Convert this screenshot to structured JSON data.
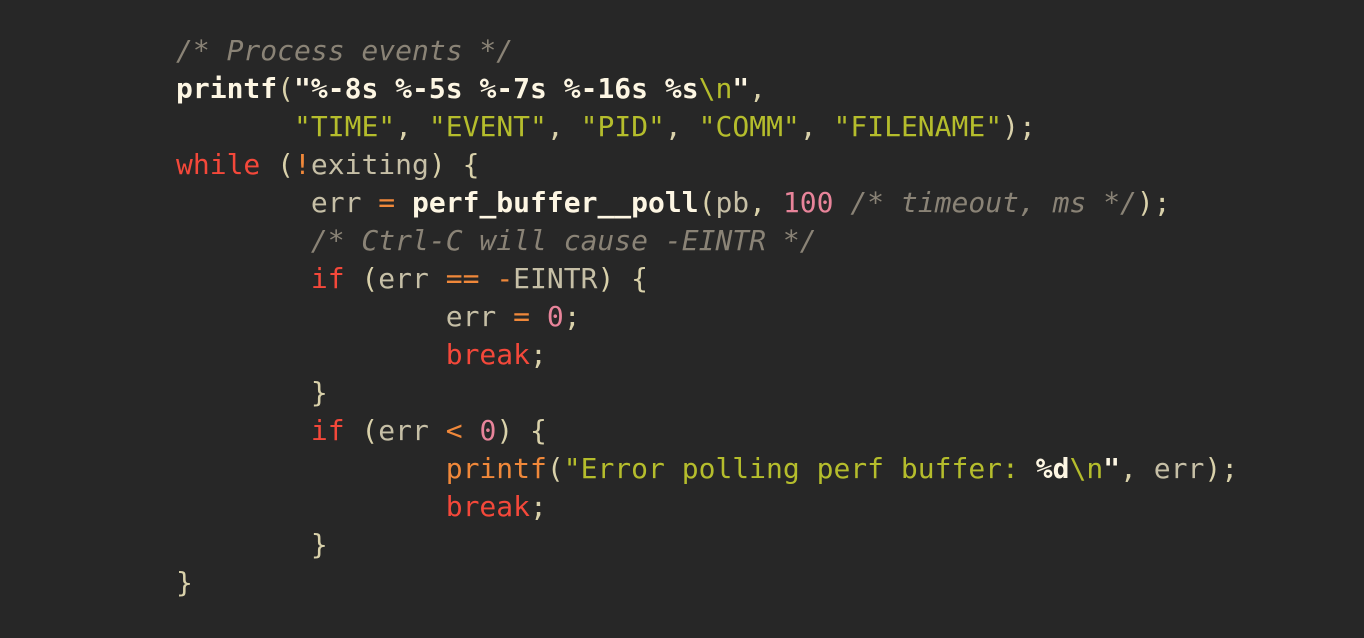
{
  "editor": {
    "background_color": "#272727",
    "font_size_px": 28,
    "line_height_px": 38,
    "language": "C"
  },
  "palette": {
    "background": "#272727",
    "comment": "#8a8376",
    "keyword": "#f4483a",
    "function_name": "#fdf6e3",
    "function_name_alt": "#f0883a",
    "identifier": "#c6bfa6",
    "operator": "#f0883a",
    "number": "#e8849a",
    "string": "#b5bd2c",
    "format_specifier": "#fdf6e3",
    "punctuation": "#d9d1aa",
    "escape": "#b5bd2c"
  },
  "code": {
    "plain_text": "/* Process events */\nprintf(\"%-8s %-5s %-7s %-16s %s\\n\",\n       \"TIME\", \"EVENT\", \"PID\", \"COMM\", \"FILENAME\");\nwhile (!exiting) {\n        err = perf_buffer__poll(pb, 100 /* timeout, ms */);\n        /* Ctrl-C will cause -EINTR */\n        if (err == -EINTR) {\n                err = 0;\n                break;\n        }\n        if (err < 0) {\n                printf(\"Error polling perf buffer: %d\\n\", err);\n                break;\n        }\n}",
    "lines": [
      {
        "id": "line-1",
        "tokens": [
          {
            "t": "/* Process events */",
            "c": "tok-comment"
          }
        ]
      },
      {
        "id": "line-2",
        "tokens": [
          {
            "t": "printf",
            "c": "tok-func"
          },
          {
            "t": "(",
            "c": "tok-punct"
          },
          {
            "t": "\"%-8s %-5s %-7s %-16s %s",
            "c": "tok-fmt"
          },
          {
            "t": "\\n",
            "c": "tok-esc"
          },
          {
            "t": "\"",
            "c": "tok-fmt"
          },
          {
            "t": ",",
            "c": "tok-punct"
          }
        ]
      },
      {
        "id": "line-3",
        "tokens": [
          {
            "t": "       ",
            "c": "tok-plain"
          },
          {
            "t": "\"TIME\"",
            "c": "tok-string"
          },
          {
            "t": ", ",
            "c": "tok-punct"
          },
          {
            "t": "\"EVENT\"",
            "c": "tok-string"
          },
          {
            "t": ", ",
            "c": "tok-punct"
          },
          {
            "t": "\"PID\"",
            "c": "tok-string"
          },
          {
            "t": ", ",
            "c": "tok-punct"
          },
          {
            "t": "\"COMM\"",
            "c": "tok-string"
          },
          {
            "t": ", ",
            "c": "tok-punct"
          },
          {
            "t": "\"FILENAME\"",
            "c": "tok-string"
          },
          {
            "t": ");",
            "c": "tok-punct"
          }
        ]
      },
      {
        "id": "line-4",
        "tokens": [
          {
            "t": "while",
            "c": "tok-keyword"
          },
          {
            "t": " (",
            "c": "tok-punct"
          },
          {
            "t": "!",
            "c": "tok-op"
          },
          {
            "t": "exiting",
            "c": "tok-ident"
          },
          {
            "t": ") {",
            "c": "tok-punct"
          }
        ]
      },
      {
        "id": "line-5",
        "tokens": [
          {
            "t": "        ",
            "c": "tok-plain"
          },
          {
            "t": "err",
            "c": "tok-ident"
          },
          {
            "t": " ",
            "c": "tok-plain"
          },
          {
            "t": "=",
            "c": "tok-op"
          },
          {
            "t": " ",
            "c": "tok-plain"
          },
          {
            "t": "perf_buffer__poll",
            "c": "tok-func"
          },
          {
            "t": "(",
            "c": "tok-punct"
          },
          {
            "t": "pb",
            "c": "tok-ident"
          },
          {
            "t": ", ",
            "c": "tok-punct"
          },
          {
            "t": "100",
            "c": "tok-number"
          },
          {
            "t": " ",
            "c": "tok-plain"
          },
          {
            "t": "/* timeout, ms */",
            "c": "tok-comment"
          },
          {
            "t": ");",
            "c": "tok-punct"
          }
        ]
      },
      {
        "id": "line-6",
        "tokens": [
          {
            "t": "        ",
            "c": "tok-plain"
          },
          {
            "t": "/* Ctrl-C will cause -EINTR */",
            "c": "tok-comment"
          }
        ]
      },
      {
        "id": "line-7",
        "tokens": [
          {
            "t": "        ",
            "c": "tok-plain"
          },
          {
            "t": "if",
            "c": "tok-keyword"
          },
          {
            "t": " (",
            "c": "tok-punct"
          },
          {
            "t": "err",
            "c": "tok-ident"
          },
          {
            "t": " ",
            "c": "tok-plain"
          },
          {
            "t": "==",
            "c": "tok-op"
          },
          {
            "t": " ",
            "c": "tok-plain"
          },
          {
            "t": "-",
            "c": "tok-op"
          },
          {
            "t": "EINTR",
            "c": "tok-ident"
          },
          {
            "t": ") {",
            "c": "tok-punct"
          }
        ]
      },
      {
        "id": "line-8",
        "tokens": [
          {
            "t": "                ",
            "c": "tok-plain"
          },
          {
            "t": "err",
            "c": "tok-ident"
          },
          {
            "t": " ",
            "c": "tok-plain"
          },
          {
            "t": "=",
            "c": "tok-op"
          },
          {
            "t": " ",
            "c": "tok-plain"
          },
          {
            "t": "0",
            "c": "tok-number"
          },
          {
            "t": ";",
            "c": "tok-punct"
          }
        ]
      },
      {
        "id": "line-9",
        "tokens": [
          {
            "t": "                ",
            "c": "tok-plain"
          },
          {
            "t": "break",
            "c": "tok-keyword"
          },
          {
            "t": ";",
            "c": "tok-punct"
          }
        ]
      },
      {
        "id": "line-10",
        "tokens": [
          {
            "t": "        ",
            "c": "tok-plain"
          },
          {
            "t": "}",
            "c": "tok-punct"
          }
        ]
      },
      {
        "id": "line-11",
        "tokens": [
          {
            "t": "        ",
            "c": "tok-plain"
          },
          {
            "t": "if",
            "c": "tok-keyword"
          },
          {
            "t": " (",
            "c": "tok-punct"
          },
          {
            "t": "err",
            "c": "tok-ident"
          },
          {
            "t": " ",
            "c": "tok-plain"
          },
          {
            "t": "<",
            "c": "tok-op"
          },
          {
            "t": " ",
            "c": "tok-plain"
          },
          {
            "t": "0",
            "c": "tok-number"
          },
          {
            "t": ") {",
            "c": "tok-punct"
          }
        ]
      },
      {
        "id": "line-12",
        "tokens": [
          {
            "t": "                ",
            "c": "tok-plain"
          },
          {
            "t": "printf",
            "c": "tok-func-alt"
          },
          {
            "t": "(",
            "c": "tok-punct"
          },
          {
            "t": "\"Error polling perf buffer: ",
            "c": "tok-string"
          },
          {
            "t": "%d",
            "c": "tok-fmt"
          },
          {
            "t": "\\n",
            "c": "tok-esc"
          },
          {
            "t": "\"",
            "c": "tok-fmt"
          },
          {
            "t": ", ",
            "c": "tok-punct"
          },
          {
            "t": "err",
            "c": "tok-ident"
          },
          {
            "t": ");",
            "c": "tok-punct"
          }
        ]
      },
      {
        "id": "line-13",
        "tokens": [
          {
            "t": "                ",
            "c": "tok-plain"
          },
          {
            "t": "break",
            "c": "tok-keyword"
          },
          {
            "t": ";",
            "c": "tok-punct"
          }
        ]
      },
      {
        "id": "line-14",
        "tokens": [
          {
            "t": "        ",
            "c": "tok-plain"
          },
          {
            "t": "}",
            "c": "tok-punct"
          }
        ]
      },
      {
        "id": "line-15",
        "tokens": [
          {
            "t": "}",
            "c": "tok-punct"
          }
        ]
      }
    ]
  }
}
